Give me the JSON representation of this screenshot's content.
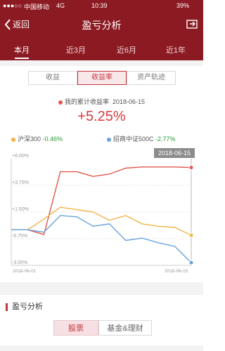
{
  "status": {
    "carrier": "中国移动",
    "network": "4G",
    "time": "10:39",
    "battery": "39%"
  },
  "nav": {
    "back_label": "返回",
    "title": "盈亏分析"
  },
  "tabs": [
    "本月",
    "近3月",
    "近6月",
    "近1年"
  ],
  "segments": [
    "收益",
    "收益率",
    "资产轨迹"
  ],
  "summary": {
    "legend_text": "我的累计收益率",
    "date": "2018-06-15",
    "value": "+5.25%"
  },
  "benchmarks": [
    {
      "name": "沪深300",
      "value": "-0.46%"
    },
    {
      "name": "招商中证500C",
      "value": "-2.77%"
    }
  ],
  "chart_badge_date": "2018-06-15",
  "chart_data": {
    "type": "line",
    "y_ticks": [
      "+6.00%",
      "+3.75%",
      "+1.50%",
      "-0.75%",
      "-3.00%"
    ],
    "x_ticks": [
      "2018-06-01",
      "2018-06-15"
    ],
    "ylim": [
      -3.0,
      6.0
    ],
    "series": [
      {
        "name": "我的累计收益率",
        "color": "#e0584e",
        "values": [
          0.0,
          0.0,
          -0.4,
          4.9,
          4.9,
          4.5,
          4.7,
          5.2,
          5.3,
          5.3,
          5.3,
          5.25
        ]
      },
      {
        "name": "沪深300",
        "color": "#f0b447",
        "values": [
          0.0,
          0.0,
          0.9,
          1.9,
          1.7,
          1.5,
          0.8,
          1.2,
          0.5,
          0.3,
          0.2,
          -0.46
        ]
      },
      {
        "name": "招商中证500C",
        "color": "#67a2dd",
        "values": [
          0.0,
          0.0,
          -0.2,
          1.2,
          1.1,
          0.3,
          0.5,
          -0.9,
          -0.7,
          -1.1,
          -1.4,
          -2.77
        ]
      }
    ]
  },
  "section": {
    "title": "盈亏分析"
  },
  "bottom_buttons": [
    "股票",
    "基金&理财"
  ]
}
